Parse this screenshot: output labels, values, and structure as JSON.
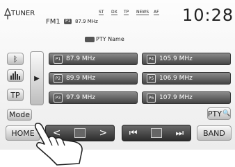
{
  "header": {
    "source": "TUNER",
    "band": "FM1",
    "preset_badge": "P1",
    "frequency": "87.9 MHz",
    "indicators": [
      "ST",
      "DX",
      "TP",
      "NEWS",
      "AF"
    ],
    "pty_name": "PTY Name",
    "clock": "10:28"
  },
  "side": {
    "tp_label": "TP",
    "mode_label": "Mode"
  },
  "presets": [
    {
      "badge": "P1",
      "freq": "87.9 MHz"
    },
    {
      "badge": "P2",
      "freq": "89.9 MHz"
    },
    {
      "badge": "P3",
      "freq": "97.9 MHz"
    },
    {
      "badge": "P4",
      "freq": "105.9 MHz"
    },
    {
      "badge": "P5",
      "freq": "106.9 MHz"
    },
    {
      "badge": "P6",
      "freq": "107.9 MHz"
    }
  ],
  "bottom": {
    "home_label": "HOME",
    "prev_glyph": "<",
    "next_glyph": ">",
    "seek_back_glyph": "⏮",
    "seek_fwd_glyph": "⏭",
    "band_label": "BAND",
    "pty_label": "PTY"
  }
}
